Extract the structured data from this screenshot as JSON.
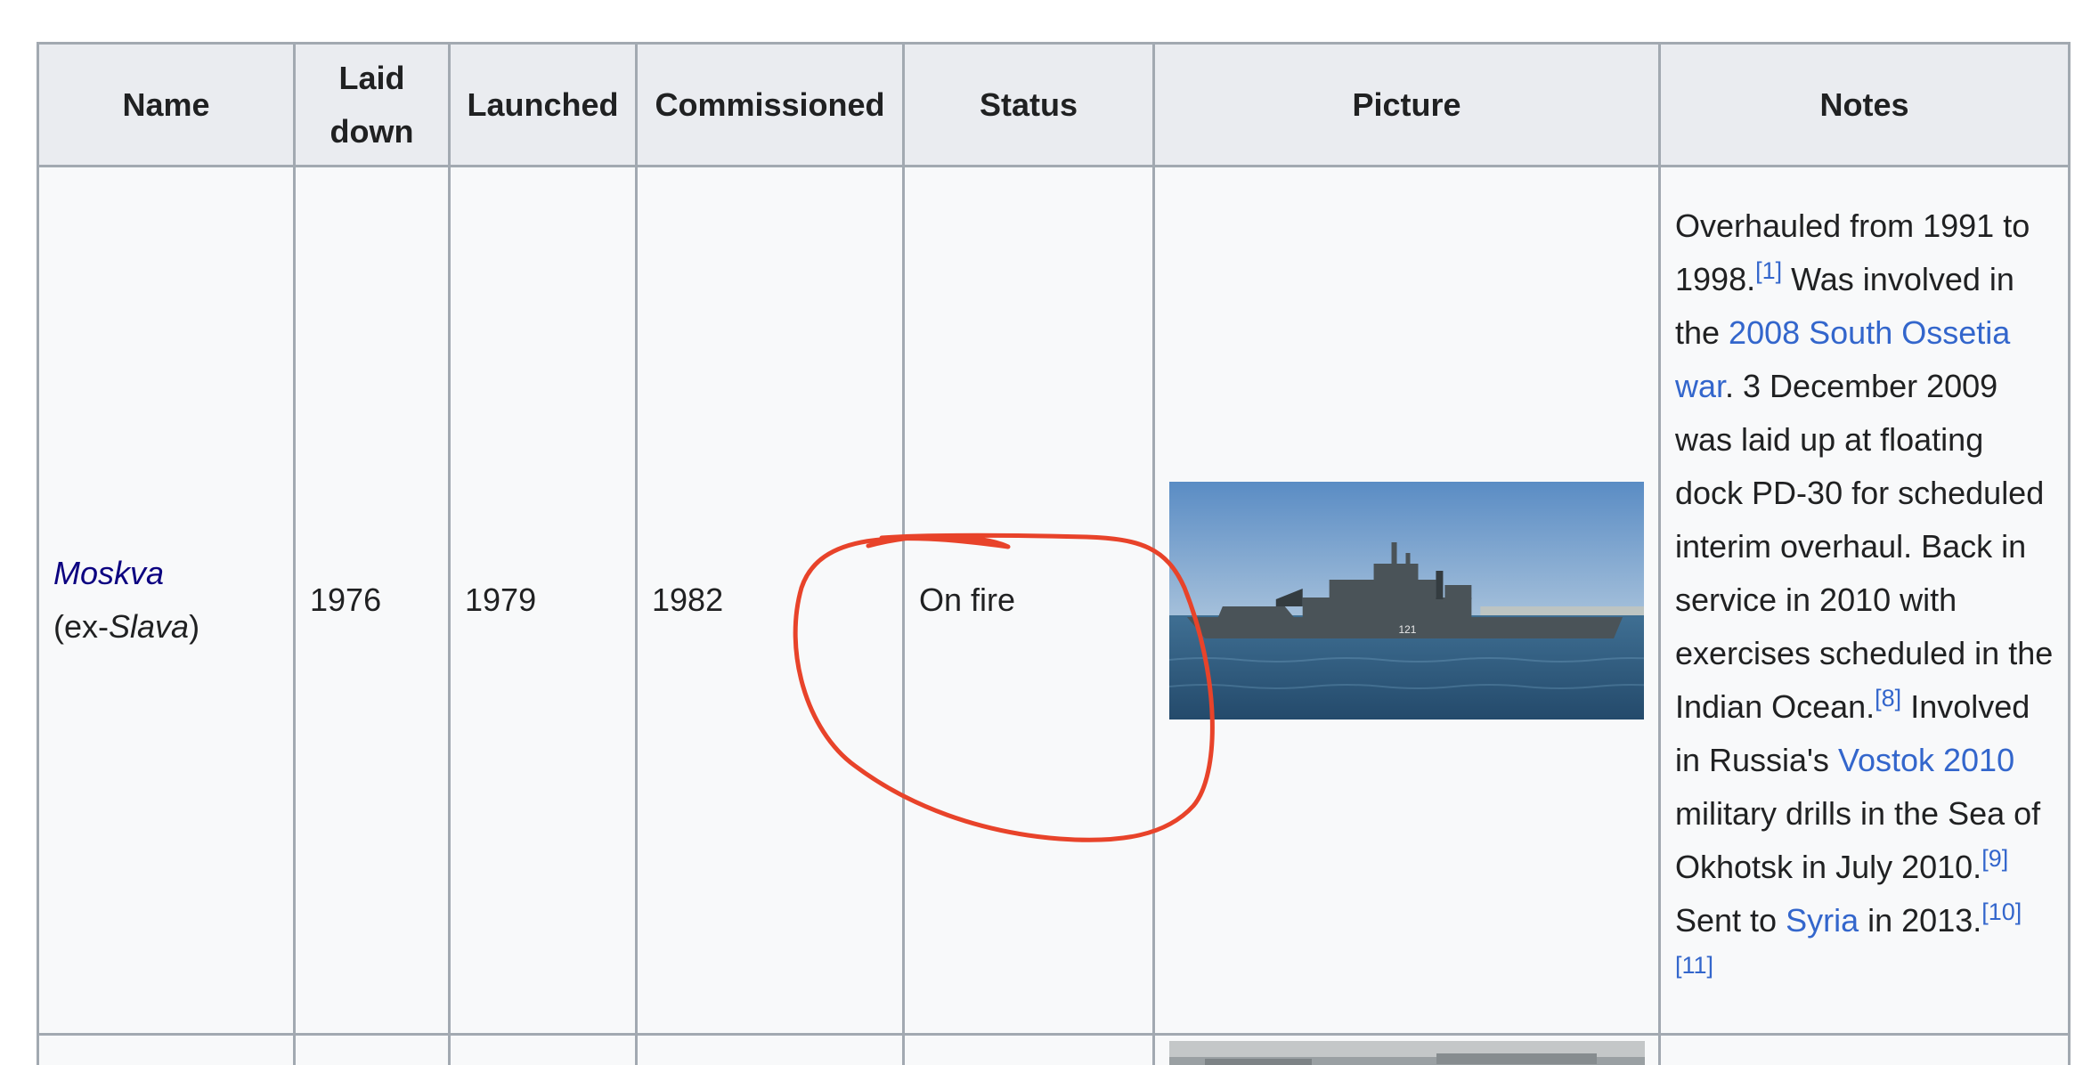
{
  "table": {
    "headers": {
      "name": "Name",
      "laid_down_line1": "Laid",
      "laid_down_line2": "down",
      "launched": "Launched",
      "commissioned": "Commissioned",
      "status": "Status",
      "picture": "Picture",
      "notes": "Notes"
    },
    "rows": [
      {
        "name_link": "Moskva",
        "name_prefix": "(ex-",
        "name_former": "Slava",
        "name_suffix": ")",
        "laid_down": "1976",
        "launched": "1979",
        "commissioned": "1982",
        "status": "On fire",
        "picture_hull_number": "121",
        "notes": {
          "t1": "Overhauled from 1991 to 1998.",
          "r1": "[1]",
          "t2": " Was involved in the ",
          "l1": "2008 South Ossetia war",
          "t3": ". 3 December 2009 was laid up at floating dock PD-30 for scheduled interim overhaul. Back in service in 2010 with exercises scheduled in the Indian Ocean.",
          "r2": "[8]",
          "t4": " Involved in Russia's ",
          "l2": "Vostok 2010",
          "t5": " military drills in the Sea of Okhotsk in July 2010.",
          "r3": "[9]",
          "t6": " Sent to ",
          "l3": "Syria",
          "t7": " in 2013.",
          "r4": "[10]",
          "r5": "[11]"
        }
      }
    ]
  },
  "colors": {
    "header_bg": "#eaecf0",
    "cell_bg": "#f8f9fa",
    "border": "#a2a9b1",
    "link": "#3366cc",
    "ship_link": "#0b0080",
    "annotation": "#e8432a"
  },
  "annotation": {
    "shape": "freehand-circle",
    "target": "status-cell"
  }
}
